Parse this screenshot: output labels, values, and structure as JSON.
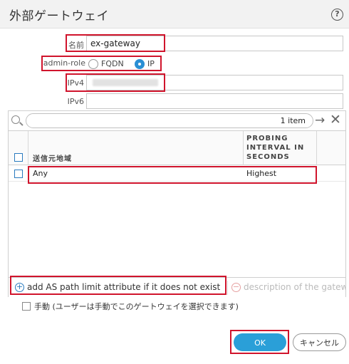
{
  "dialog": {
    "title": "外部ゲートウェイ",
    "help_icon": "help-icon",
    "help_glyph": "?"
  },
  "form": {
    "name_label": "名前",
    "name_value": "ex-gateway",
    "admin_role_label": "admin-role",
    "admin_role_options": [
      "FQDN",
      "IP"
    ],
    "admin_role_selected": "IP",
    "ipv4_label": "IPv4",
    "ipv6_label": "IPv6",
    "ipv6_value": ""
  },
  "grid": {
    "search_count": "1 item",
    "arrow_glyph": "→",
    "close_glyph": "✕",
    "columns": [
      "送信元地域",
      "PROBING INTERVAL IN SECONDS"
    ],
    "rows": [
      {
        "source_region": "Any",
        "probing_interval": "Highest"
      }
    ]
  },
  "bottombar": {
    "add_label": "add AS path limit attribute if it does not exist",
    "description_label": "description of the gatew",
    "add_glyph": "+",
    "remove_glyph": "−"
  },
  "manual": {
    "label": "手動 (ユーザーは手動でこのゲートウェイを選択できます)",
    "checked": false
  },
  "buttons": {
    "ok": "OK",
    "cancel": "キャンセル"
  },
  "colors": {
    "accent": "#2a9fd8",
    "highlight_border": "#d0142c"
  }
}
